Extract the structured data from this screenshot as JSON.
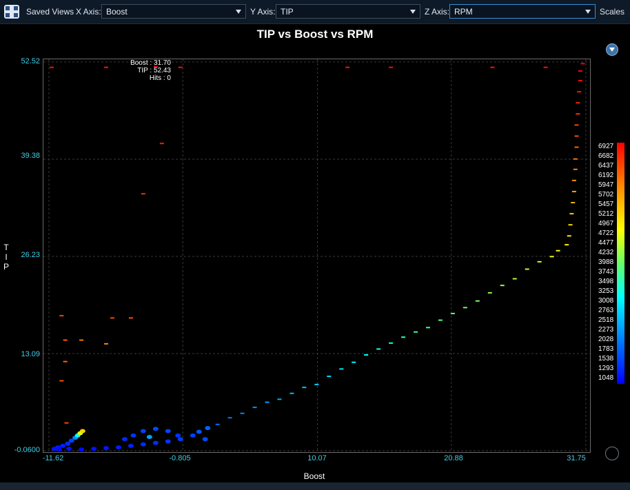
{
  "toolbar": {
    "saved_views_label": "Saved Views",
    "x_axis_label": "X Axis:",
    "x_axis_value": "Boost",
    "y_axis_label": "Y Axis:",
    "y_axis_value": "TIP",
    "z_axis_label": "Z Axis:",
    "z_axis_value": "RPM",
    "scales_label": "Scales"
  },
  "cursor_info": {
    "boost": "Boost : 31.70",
    "tip": "TIP : 52.43",
    "hits": "Hits : 0"
  },
  "legend": {
    "labels": [
      "6927",
      "6682",
      "6437",
      "6192",
      "5947",
      "5702",
      "5457",
      "5212",
      "4967",
      "4722",
      "4477",
      "4232",
      "3988",
      "3743",
      "3498",
      "3253",
      "3008",
      "2763",
      "2518",
      "2273",
      "2028",
      "1783",
      "1538",
      "1293",
      "1048"
    ]
  },
  "colors": {
    "tick_text": "#3fd1e8",
    "background": "#000000"
  },
  "chart_data": {
    "type": "scatter",
    "title": "TIP vs Boost vs RPM",
    "xlabel": "Boost",
    "ylabel": "TIP",
    "zlabel": "RPM",
    "xlim": [
      -11.62,
      31.75
    ],
    "ylim": [
      -0.06,
      52.52
    ],
    "zlim": [
      1048,
      6927
    ],
    "x_ticks": [
      "-11.62",
      "-0.805",
      "10.07",
      "20.88",
      "31.75"
    ],
    "y_ticks": [
      "52.52",
      "39.38",
      "26.23",
      "13.09",
      "-0.0600"
    ],
    "grid": true,
    "legend_position": "right",
    "points": [
      [
        -11.2,
        0.2,
        1200
      ],
      [
        -10.9,
        0.4,
        1250
      ],
      [
        -10.5,
        0.6,
        1300
      ],
      [
        -10.1,
        0.9,
        1400
      ],
      [
        -9.8,
        1.3,
        1600
      ],
      [
        -9.5,
        1.7,
        2200
      ],
      [
        -9.3,
        2.0,
        3200
      ],
      [
        -9.1,
        2.3,
        4600
      ],
      [
        -8.9,
        2.6,
        5200
      ],
      [
        -10.8,
        0.1,
        1150
      ],
      [
        -10.0,
        0.2,
        1200
      ],
      [
        -9.0,
        0.1,
        1150
      ],
      [
        -8.0,
        0.2,
        1200
      ],
      [
        -7.0,
        0.3,
        1250
      ],
      [
        -6.0,
        0.4,
        1300
      ],
      [
        -5.0,
        0.6,
        1350
      ],
      [
        -4.0,
        0.8,
        1400
      ],
      [
        -3.0,
        1.0,
        1450
      ],
      [
        -2.0,
        1.2,
        1500
      ],
      [
        -1.0,
        1.5,
        1550
      ],
      [
        -5.5,
        1.5,
        1400
      ],
      [
        -4.8,
        2.0,
        1500
      ],
      [
        -4.0,
        2.6,
        1600
      ],
      [
        -3.0,
        2.9,
        1700
      ],
      [
        -2.0,
        2.6,
        1650
      ],
      [
        -3.5,
        1.8,
        2400
      ],
      [
        -1.2,
        2.0,
        1500
      ],
      [
        0.0,
        2.0,
        1600
      ],
      [
        1.0,
        1.5,
        1700
      ],
      [
        0.5,
        2.5,
        1800
      ],
      [
        1.2,
        3.0,
        1900
      ],
      [
        2.0,
        3.5,
        2000
      ],
      [
        3.0,
        4.4,
        2100
      ],
      [
        4.0,
        5.0,
        2200
      ],
      [
        5.0,
        5.8,
        2300
      ],
      [
        6.0,
        6.5,
        2400
      ],
      [
        7.0,
        6.9,
        2500
      ],
      [
        8.0,
        7.7,
        2600
      ],
      [
        9.0,
        8.5,
        2700
      ],
      [
        10.0,
        8.9,
        2800
      ],
      [
        11.0,
        10.0,
        2900
      ],
      [
        12.0,
        11.0,
        3000
      ],
      [
        13.0,
        11.9,
        3100
      ],
      [
        14.0,
        12.9,
        3200
      ],
      [
        15.0,
        13.7,
        3300
      ],
      [
        16.0,
        14.5,
        3400
      ],
      [
        17.0,
        15.3,
        3500
      ],
      [
        18.0,
        16.0,
        3600
      ],
      [
        19.0,
        16.6,
        3700
      ],
      [
        20.0,
        17.6,
        3800
      ],
      [
        21.0,
        18.5,
        3900
      ],
      [
        22.0,
        19.3,
        4000
      ],
      [
        23.0,
        20.2,
        4100
      ],
      [
        24.0,
        21.3,
        4200
      ],
      [
        25.0,
        22.3,
        4300
      ],
      [
        26.0,
        23.2,
        4400
      ],
      [
        27.0,
        24.5,
        4500
      ],
      [
        28.0,
        25.5,
        4600
      ],
      [
        29.0,
        26.2,
        4700
      ],
      [
        29.5,
        27.0,
        4800
      ],
      [
        30.2,
        27.8,
        4900
      ],
      [
        30.4,
        29.0,
        5000
      ],
      [
        30.5,
        30.5,
        5150
      ],
      [
        30.6,
        32.0,
        5300
      ],
      [
        30.7,
        33.5,
        5450
      ],
      [
        30.8,
        35.0,
        5600
      ],
      [
        30.8,
        36.5,
        5750
      ],
      [
        30.9,
        38.0,
        5900
      ],
      [
        30.9,
        39.4,
        6000
      ],
      [
        31.0,
        41.0,
        6150
      ],
      [
        31.0,
        42.5,
        6300
      ],
      [
        31.0,
        44.0,
        6400
      ],
      [
        31.1,
        45.5,
        6550
      ],
      [
        31.1,
        47.0,
        6650
      ],
      [
        31.2,
        48.5,
        6750
      ],
      [
        31.3,
        50.0,
        6850
      ],
      [
        31.3,
        51.3,
        6900
      ],
      [
        31.5,
        52.3,
        6927
      ],
      [
        -10.6,
        18.2,
        6400
      ],
      [
        -10.3,
        14.9,
        6200
      ],
      [
        -10.3,
        12.0,
        6150
      ],
      [
        -10.6,
        9.4,
        6300
      ],
      [
        -10.2,
        3.7,
        6400
      ],
      [
        -9.0,
        14.9,
        6000
      ],
      [
        -7.0,
        14.4,
        5900
      ],
      [
        -4.0,
        34.7,
        6600
      ],
      [
        -2.5,
        41.5,
        6700
      ],
      [
        -11.4,
        51.8,
        6800
      ],
      [
        -7.0,
        51.8,
        6800
      ],
      [
        -3.0,
        51.9,
        6850
      ],
      [
        -1.0,
        51.8,
        6800
      ],
      [
        12.5,
        51.8,
        6800
      ],
      [
        16.0,
        51.8,
        6850
      ],
      [
        24.2,
        51.8,
        6800
      ],
      [
        28.5,
        51.8,
        6800
      ],
      [
        -5.0,
        17.9,
        6300
      ],
      [
        -6.5,
        17.9,
        6400
      ]
    ]
  }
}
